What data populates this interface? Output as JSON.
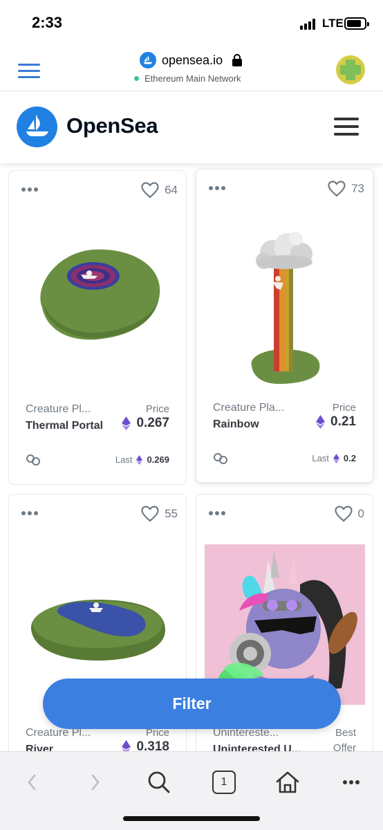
{
  "status_bar": {
    "time": "2:33",
    "network": "LTE"
  },
  "wallet_bar": {
    "url": "opensea.io",
    "network": "Ethereum Main Network"
  },
  "header": {
    "brand": "OpenSea"
  },
  "cards": [
    {
      "favorites": "64",
      "collection": "Creature Pl...",
      "name": "Thermal Portal",
      "price_label": "Price",
      "price": "0.267",
      "last_label": "Last",
      "last_price": "0.269"
    },
    {
      "favorites": "73",
      "collection": "Creature Pla...",
      "name": "Rainbow",
      "price_label": "Price",
      "price": "0.21",
      "last_label": "Last",
      "last_price": "0.2"
    },
    {
      "favorites": "55",
      "collection": "Creature Pl...",
      "name": "River",
      "price_label": "Price",
      "price": "0.318"
    },
    {
      "favorites": "0",
      "collection": "Unintereste...",
      "name": "Uninterested U...",
      "price_label": "Best",
      "price_label_2": "Offer"
    }
  ],
  "filter": {
    "label": "Filter"
  },
  "toolbar": {
    "tab_count": "1"
  },
  "colors": {
    "brand_blue": "#2081e2",
    "filter_blue": "#3b7fe0",
    "eth_purple": "#6c4fcf",
    "price_text": "#353840",
    "muted_text": "#707a83"
  }
}
